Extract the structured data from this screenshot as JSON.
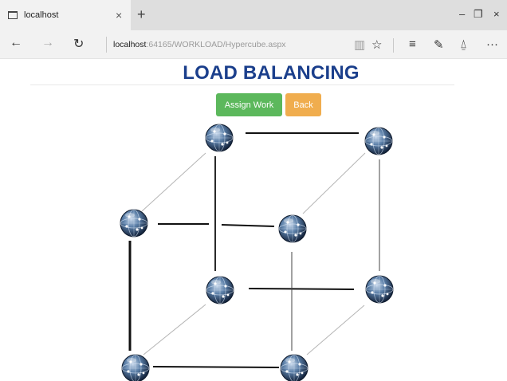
{
  "browser": {
    "tab_title": "localhost",
    "tab_close_glyph": "×",
    "new_tab_glyph": "+",
    "window_controls": {
      "minimize": "–",
      "maximize": "❐",
      "close": "×"
    },
    "url_host": "localhost",
    "url_path": ":64165/WORKLOAD/Hypercube.aspx",
    "nav": {
      "back": "←",
      "forward": "→",
      "refresh": "↻"
    },
    "tools": {
      "reading_view": "▥",
      "favorite": "☆",
      "hub": "≡",
      "notes": "✎",
      "share": "⍙",
      "more": "···"
    }
  },
  "page": {
    "title": "LOAD BALANCING",
    "buttons": {
      "assign": "Assign Work",
      "back": "Back"
    },
    "colors": {
      "title": "#1b3f8c",
      "assign": "#5cb85c",
      "back": "#f0ad4e"
    }
  },
  "cube": {
    "node_icon": "globe-network-icon",
    "node_count": 8
  }
}
